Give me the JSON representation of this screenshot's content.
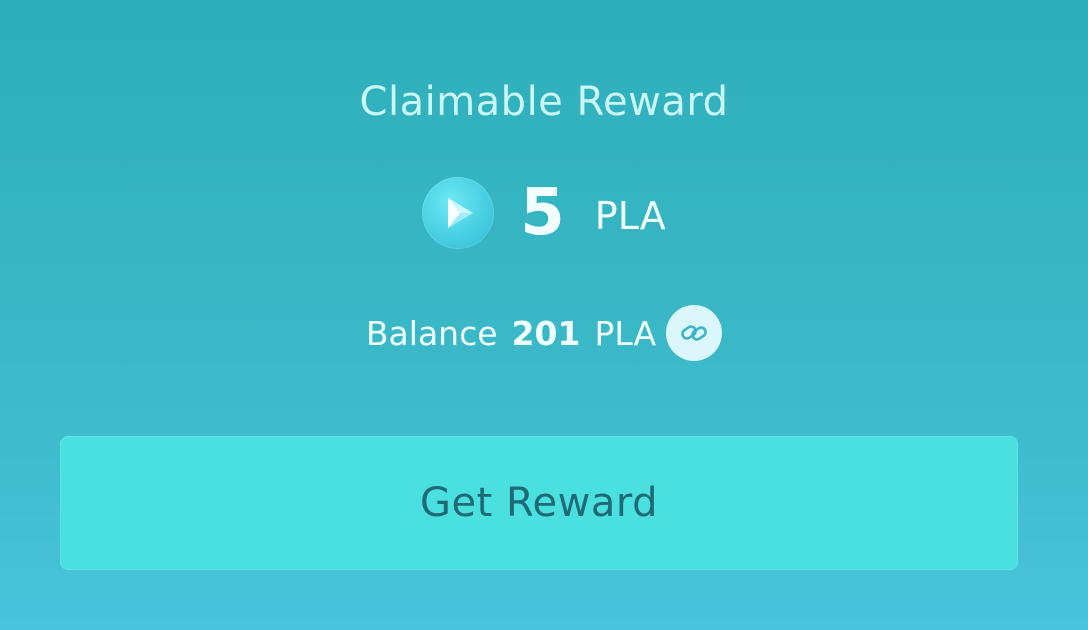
{
  "header": {
    "title": "Claimable Reward"
  },
  "reward": {
    "token_icon": "play-token-icon",
    "amount": "5",
    "unit": "PLA"
  },
  "balance": {
    "label": "Balance",
    "value": "201",
    "unit": "PLA",
    "link_icon": "chain-link-icon"
  },
  "actions": {
    "get_reward_label": "Get Reward"
  },
  "colors": {
    "background_top": "#2eaeba",
    "background_bottom": "#49c3db",
    "button_fill": "#4be0e0",
    "button_text": "#1f6a74"
  }
}
